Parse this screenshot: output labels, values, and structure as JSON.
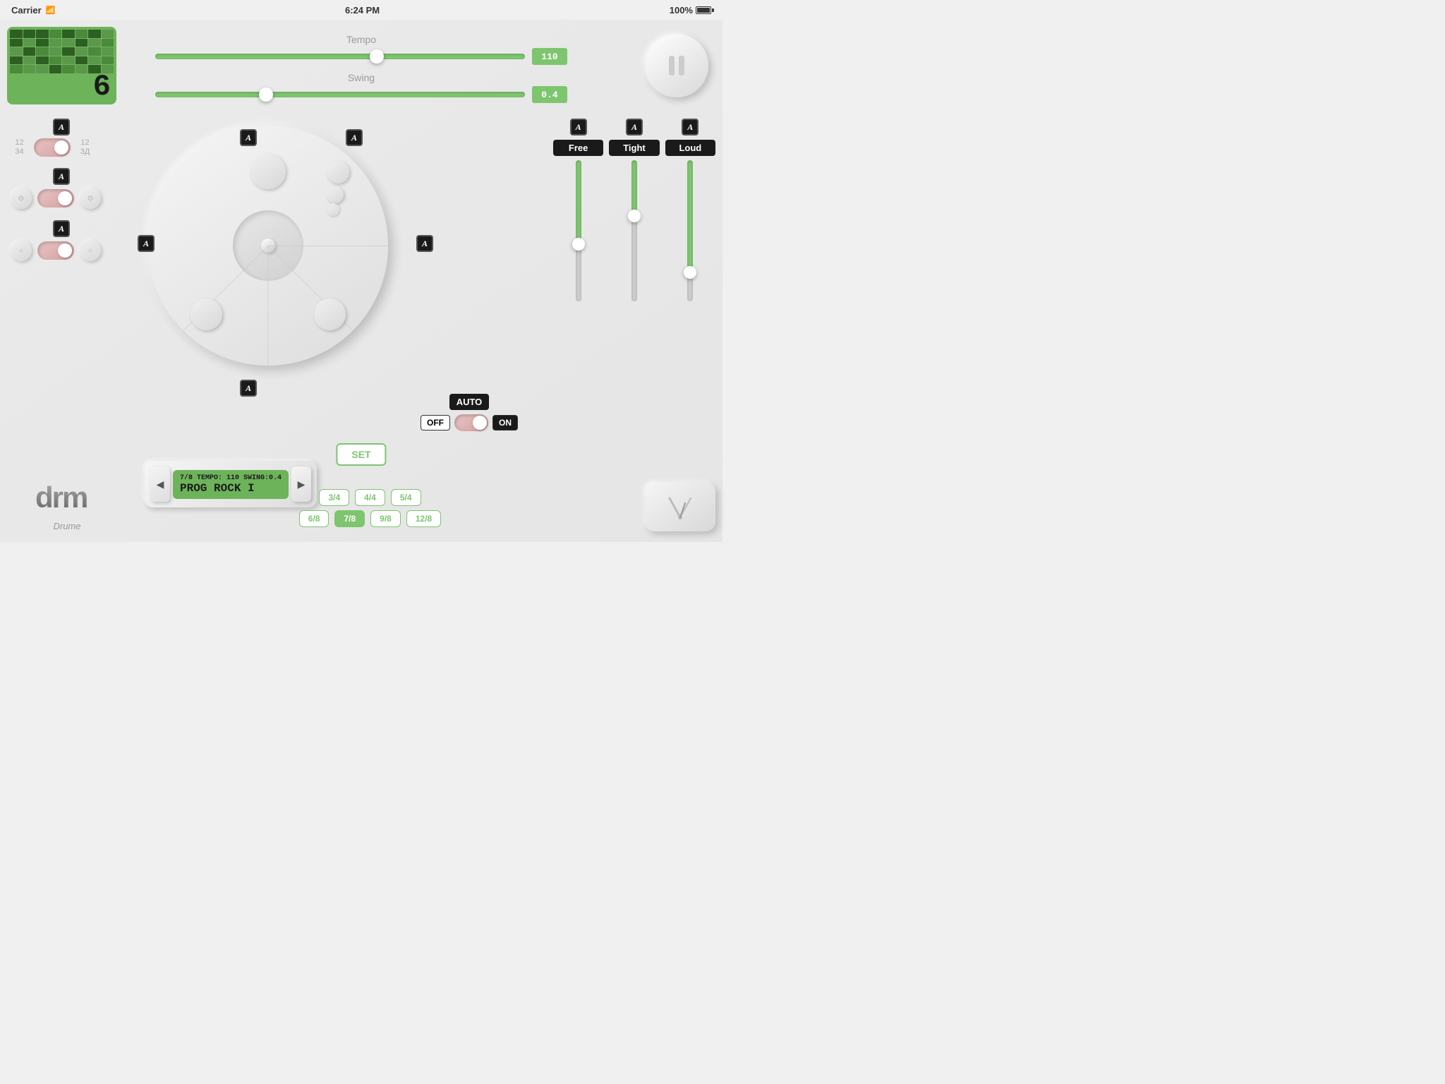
{
  "statusBar": {
    "carrier": "Carrier",
    "time": "6:24 PM",
    "battery": "100%"
  },
  "tempo": {
    "label": "Tempo",
    "value": "110",
    "sliderPos": "60"
  },
  "swing": {
    "label": "Swing",
    "value": "0.4",
    "sliderPos": "30"
  },
  "sequencer": {
    "number": "6"
  },
  "pauseButton": {
    "label": "pause"
  },
  "drumPads": {
    "aLabels": [
      "A",
      "A",
      "A",
      "A",
      "A",
      "A",
      "A"
    ]
  },
  "leftPanel": {
    "timeSig1a": "12",
    "timeSig1b": "34",
    "timeSig2a": "12",
    "timeSig2b": "3Д"
  },
  "rightPanel": {
    "aLabel": "A",
    "freeLabel": "Free",
    "tightLabel": "Tight",
    "loudLabel": "Loud",
    "aLabel2": "A",
    "aLabel3": "A"
  },
  "autoSection": {
    "autoLabel": "AUTO",
    "offLabel": "OFF",
    "onLabel": "ON"
  },
  "setButton": {
    "label": "SET"
  },
  "songDisplay": {
    "infoLine": "7/8 TEMPO: 110  SWING:0.4",
    "songName": "PROG ROCK I"
  },
  "timeSigs": {
    "row1": [
      "3/4",
      "4/4",
      "5/4"
    ],
    "row2": [
      "6/8",
      "7/8",
      "9/8",
      "12/8"
    ],
    "active": "7/8"
  },
  "logo": {
    "text": "Drume"
  },
  "navButtons": {
    "prev": "◀",
    "next": "▶"
  }
}
